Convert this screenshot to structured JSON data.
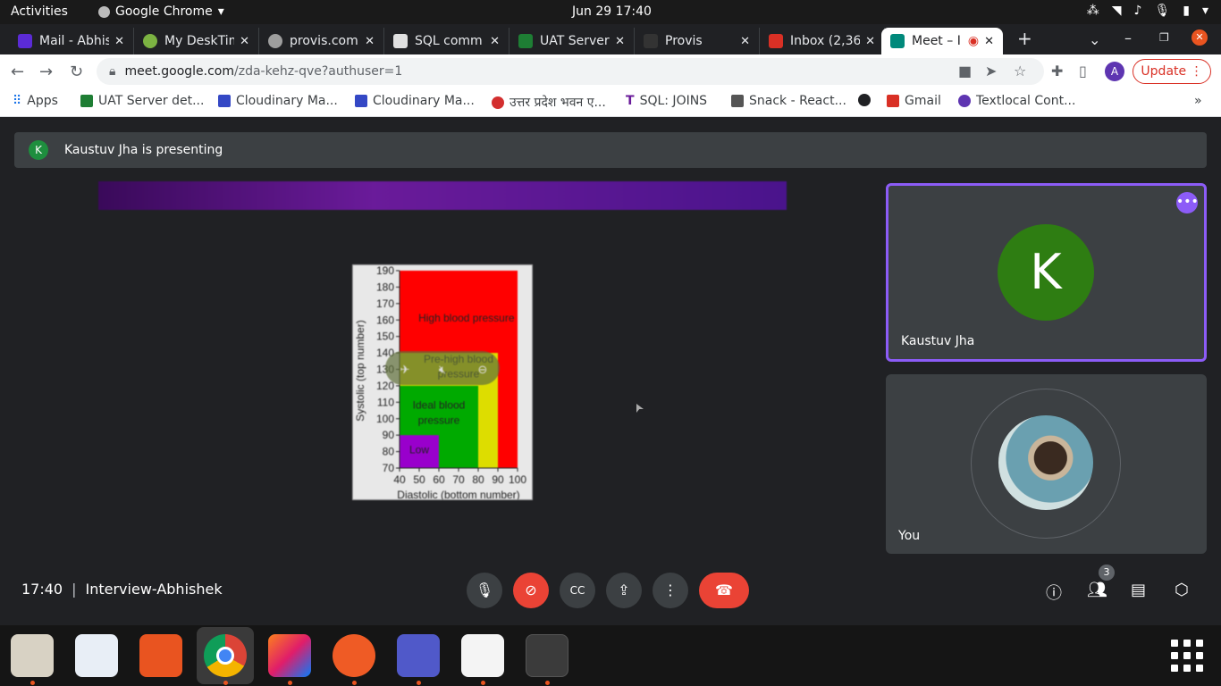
{
  "topbar": {
    "activities": "Activities",
    "app_name": "Google Chrome",
    "clock": "Jun 29  17:40"
  },
  "tabs": [
    {
      "title": "Mail - Abhis",
      "color": "#5b2bd6"
    },
    {
      "title": "My DeskTim",
      "color": "#7cb342"
    },
    {
      "title": "provis.com",
      "color": "#9e9e9e"
    },
    {
      "title": "SQL comm",
      "color": "#e0e0e0"
    },
    {
      "title": "UAT Server",
      "color": "#1e7e34"
    },
    {
      "title": "Provis",
      "color": "#333333"
    },
    {
      "title": "Inbox (2,36",
      "color": "#d93025"
    },
    {
      "title": "Meet – I",
      "color": "#00897b"
    }
  ],
  "toolbar": {
    "url_host": "meet.google.com",
    "url_path": "/zda-kehz-qve?authuser=1",
    "profile_initial": "A",
    "update_label": "Update"
  },
  "bookmarks": [
    {
      "label": "Apps"
    },
    {
      "label": "UAT Server det..."
    },
    {
      "label": "Cloudinary Ma..."
    },
    {
      "label": "Cloudinary Ma..."
    },
    {
      "label": "उत्तर प्रदेश भवन ए..."
    },
    {
      "label": "SQL: JOINS"
    },
    {
      "label": "Snack - React..."
    },
    {
      "label": ""
    },
    {
      "label": "Gmail"
    },
    {
      "label": "Textlocal Cont..."
    }
  ],
  "meet": {
    "presenter_initial": "K",
    "presenting_text": "Kaustuv Jha is presenting",
    "tiles": {
      "kaustuv_initial": "K",
      "kaustuv_name": "Kaustuv Jha",
      "you_name": "You"
    },
    "time": "17:40",
    "meeting_name": "Interview-Abhishek",
    "participants_count": "3"
  },
  "chart_data": {
    "type": "area",
    "xlabel": "Diastolic (bottom number)",
    "ylabel": "Systolic (top number)",
    "x_ticks": [
      "40",
      "50",
      "60",
      "70",
      "80",
      "90",
      "100"
    ],
    "y_ticks": [
      "70",
      "80",
      "90",
      "100",
      "110",
      "120",
      "130",
      "140",
      "150",
      "160",
      "170",
      "180",
      "190"
    ],
    "xlim": [
      40,
      100
    ],
    "ylim": [
      70,
      190
    ],
    "regions": [
      {
        "name": "High blood pressure",
        "x": [
          40,
          100
        ],
        "y": [
          70,
          190
        ],
        "color": "#ff0000"
      },
      {
        "name": "Pre-high blood pressure",
        "x": [
          40,
          90
        ],
        "y": [
          70,
          140
        ],
        "color": "#dddd00"
      },
      {
        "name": "Ideal blood pressure",
        "x": [
          40,
          80
        ],
        "y": [
          70,
          120
        ],
        "color": "#00aa00"
      },
      {
        "name": "Low",
        "x": [
          40,
          60
        ],
        "y": [
          70,
          90
        ],
        "color": "#9900cc"
      }
    ],
    "region_labels": [
      "High blood pressure",
      "Pre-high blood",
      "pressure",
      "Ideal blood",
      "pressure",
      "Low"
    ]
  }
}
